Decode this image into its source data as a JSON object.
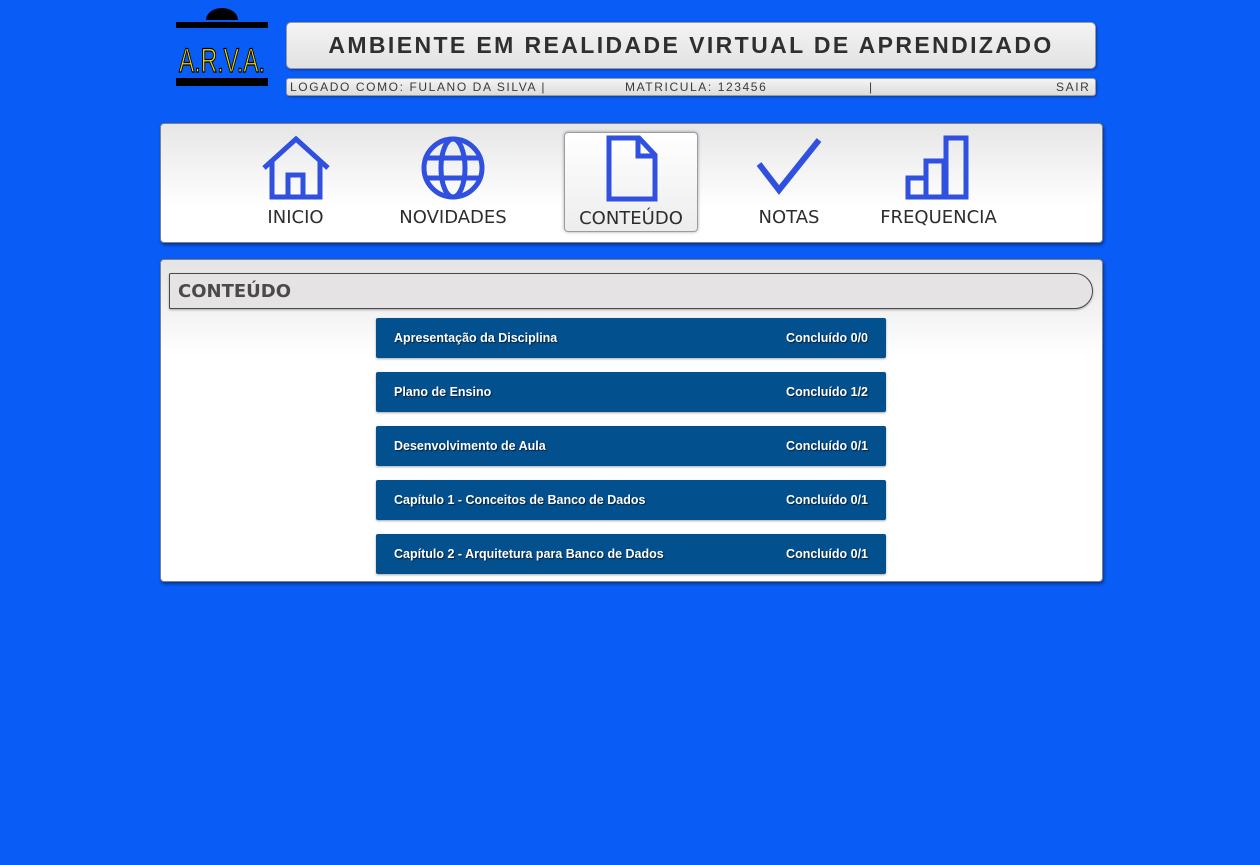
{
  "logo": {
    "text": "A.R.V.A.",
    "colors": {
      "bg": "#000000",
      "text": "#f5d400"
    }
  },
  "header": {
    "title": "AMBIENTE EM REALIDADE VIRTUAL DE APRENDIZADO",
    "login_label": "LOGADO COMO: FULANO DA SILVA |",
    "matricula": "MATRICULA: 123456",
    "separator": "|",
    "logout": "SAIR"
  },
  "nav": {
    "active": "conteudo",
    "items": [
      {
        "id": "inicio",
        "label": "INICIO",
        "icon": "home-icon"
      },
      {
        "id": "novidades",
        "label": "NOVIDADES",
        "icon": "globe-icon"
      },
      {
        "id": "conteudo",
        "label": "CONTEÚDO",
        "icon": "document-icon"
      },
      {
        "id": "notas",
        "label": "NOTAS",
        "icon": "checkmark-icon"
      },
      {
        "id": "frequencia",
        "label": "FREQUENCIA",
        "icon": "bar-chart-icon"
      }
    ]
  },
  "content": {
    "title": "CONTEÚDO",
    "modules": [
      {
        "title": "Apresentação da Disciplina",
        "status": "Concluído 0/0"
      },
      {
        "title": "Plano de Ensino",
        "status": "Concluído 1/2"
      },
      {
        "title": "Desenvolvimento de Aula",
        "status": "Concluído 0/1"
      },
      {
        "title": "Capítulo 1 - Conceitos de Banco de Dados",
        "status": "Concluído 0/1"
      },
      {
        "title": "Capítulo 2 - Arquitetura para Banco de Dados",
        "status": "Concluído 0/1"
      }
    ]
  },
  "colors": {
    "page_bg": "#0a5cf7",
    "icon": "#3050e0",
    "module_bg": "#03508f"
  }
}
